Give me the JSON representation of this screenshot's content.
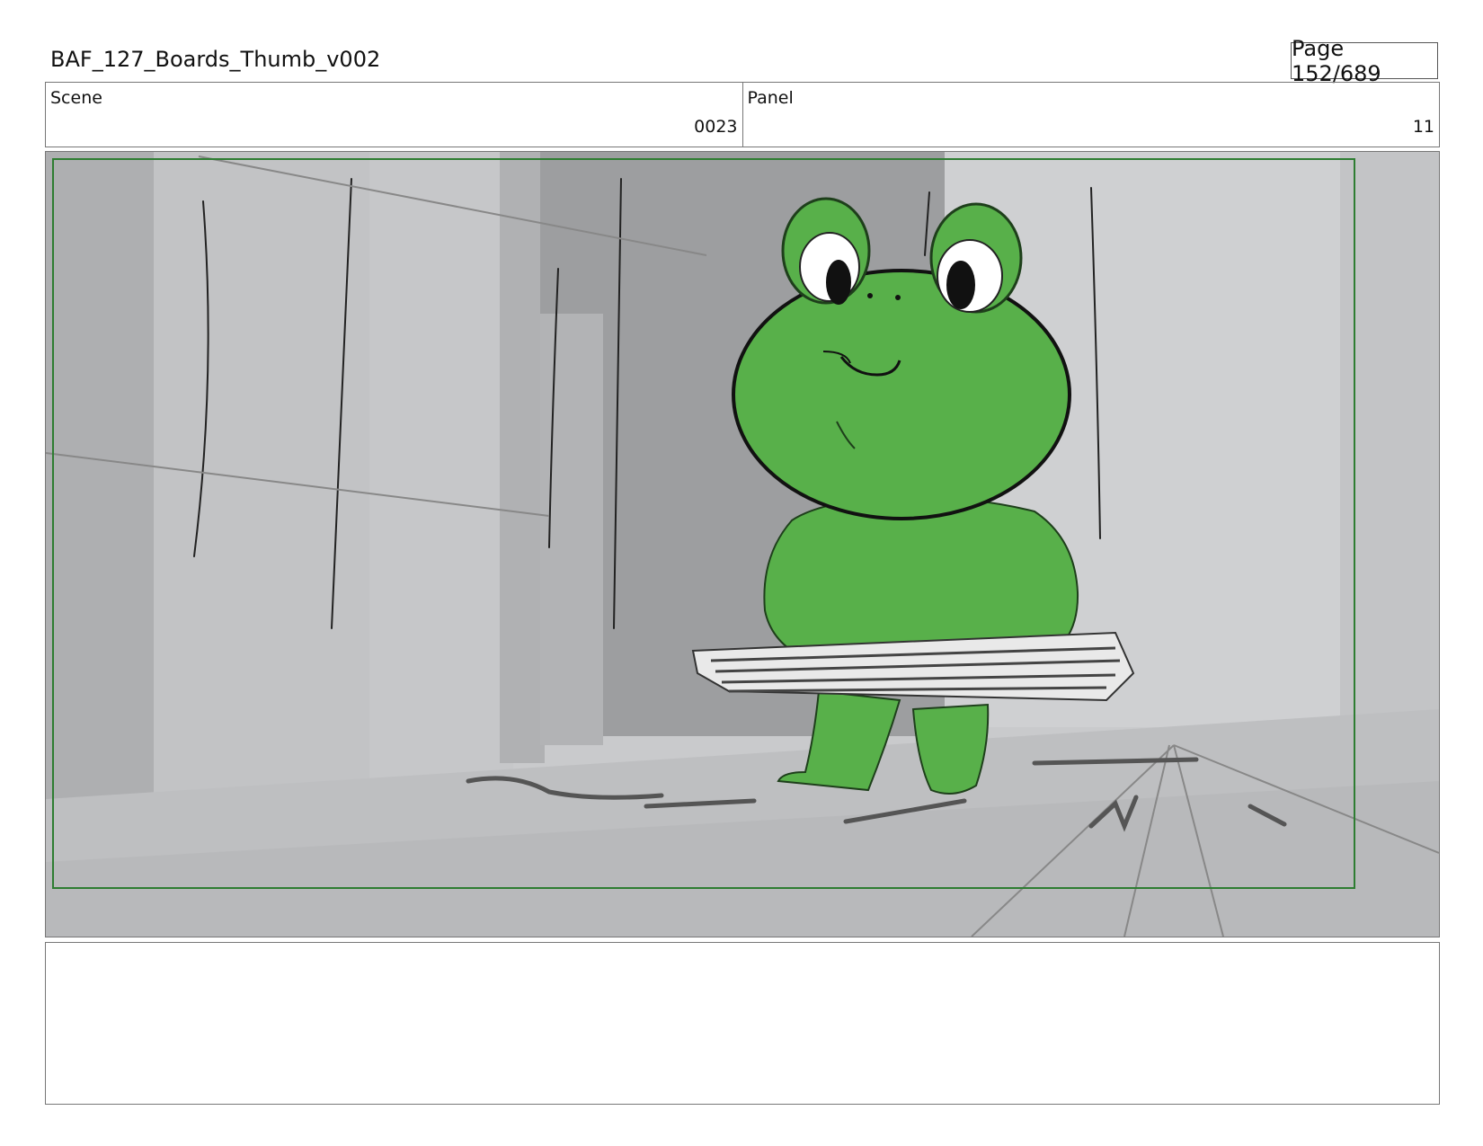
{
  "header": {
    "title": "BAF_127_Boards_Thumb_v002",
    "page": "Page 152/689"
  },
  "info": {
    "scene_label": "Scene",
    "scene_value": "0023",
    "panel_label": "Panel",
    "panel_value": "11"
  },
  "panel_image": {
    "subject": "frog-character-carrying-keyboard",
    "colors": {
      "frog": "#58b04a",
      "frame_border": "#2e7d32",
      "background": "#c8c9cb"
    }
  },
  "notes": {
    "text": ""
  }
}
